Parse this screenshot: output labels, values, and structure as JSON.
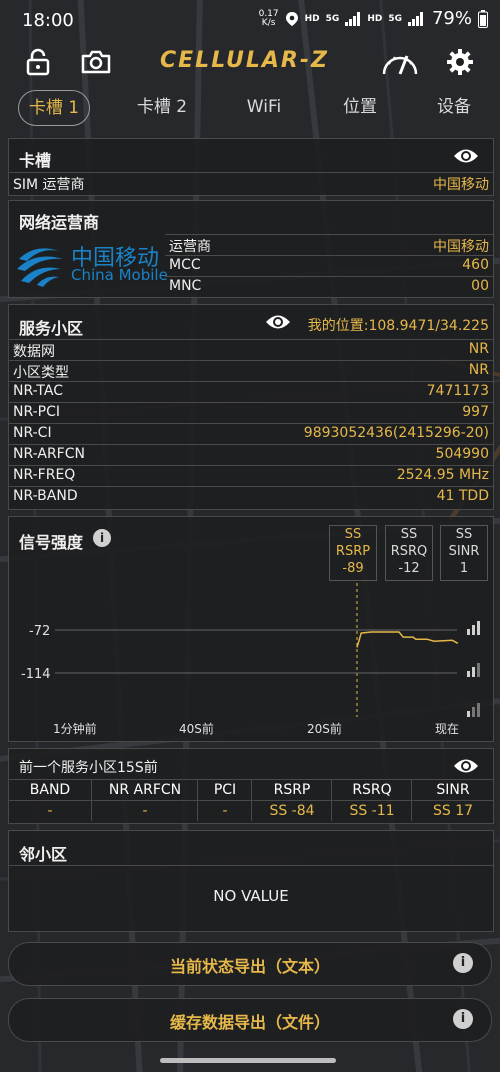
{
  "status": {
    "time": "18:00",
    "speed_value": "0.17",
    "speed_unit": "K/s",
    "hd1": "HD",
    "net1": "5G",
    "hd2": "HD",
    "net2": "5G",
    "battery": "79%"
  },
  "toolbar": {
    "app_name": "CELLULAR-Z"
  },
  "tabs": [
    {
      "label": "卡槽 1"
    },
    {
      "label": "卡槽 2"
    },
    {
      "label": "WiFi"
    },
    {
      "label": "位置"
    },
    {
      "label": "设备"
    }
  ],
  "sim": {
    "title": "卡槽",
    "carrier_key": "SIM 运营商",
    "carrier_value": "中国移动"
  },
  "operator": {
    "title": "网络运营商",
    "logo_cn": "中国移动",
    "logo_en": "China Mobile",
    "rows": [
      {
        "k": "运营商",
        "v": "中国移动"
      },
      {
        "k": "MCC",
        "v": "460"
      },
      {
        "k": "MNC",
        "v": "00"
      }
    ]
  },
  "cell": {
    "title": "服务小区",
    "location": "我的位置:108.9471/34.225",
    "rows": [
      {
        "k": "数据网",
        "v": "NR"
      },
      {
        "k": "小区类型",
        "v": "NR"
      },
      {
        "k": "NR-TAC",
        "v": "7471173"
      },
      {
        "k": "NR-PCI",
        "v": "997"
      },
      {
        "k": "NR-CI",
        "v": "9893052436(2415296-20)"
      },
      {
        "k": "NR-ARFCN",
        "v": "504990"
      },
      {
        "k": "NR-FREQ",
        "v": "2524.95 MHz"
      },
      {
        "k": "NR-BAND",
        "v": "41 TDD"
      }
    ]
  },
  "signal": {
    "title": "信号强度",
    "boxes": [
      {
        "l1": "SS",
        "l2": "RSRP",
        "l3": "-89"
      },
      {
        "l1": "SS",
        "l2": "RSRQ",
        "l3": "-12"
      },
      {
        "l1": "SS",
        "l2": "SINR",
        "l3": "1"
      }
    ],
    "colors": {
      "line": "#e6b84a",
      "grid": "#666666"
    }
  },
  "chart_data": {
    "type": "line",
    "title": "",
    "x_ticks": [
      "1分钟前",
      "40S前",
      "20S前",
      "现在"
    ],
    "y_ticks": [
      "-72",
      "-114"
    ],
    "series": [
      {
        "values": [
          {
            "x": 0.0,
            "y": -89
          },
          {
            "x": 0.3,
            "y": -75
          },
          {
            "x": 1.0,
            "y": -74
          },
          {
            "x": 3.0,
            "y": -74
          },
          {
            "x": 3.3,
            "y": -79
          },
          {
            "x": 4.0,
            "y": -79
          },
          {
            "x": 4.2,
            "y": -81
          },
          {
            "x": 5.0,
            "y": -81
          },
          {
            "x": 5.5,
            "y": -83
          },
          {
            "x": 6.8,
            "y": -82
          },
          {
            "x": 7.2,
            "y": -85
          }
        ]
      }
    ]
  },
  "prev_cell": {
    "title": "前一个服务小区15S前",
    "headers": [
      "BAND",
      "NR ARFCN",
      "PCI",
      "RSRP",
      "RSRQ",
      "SINR"
    ],
    "values": [
      "-",
      "-",
      "-",
      "SS -84",
      "SS -11",
      "SS 17"
    ]
  },
  "neighbor": {
    "title": "邻小区",
    "empty_text": "NO VALUE"
  },
  "buttons": {
    "export_text": "当前状态导出（文本）",
    "export_file": "缓存数据导出（文件）",
    "info": "i"
  }
}
